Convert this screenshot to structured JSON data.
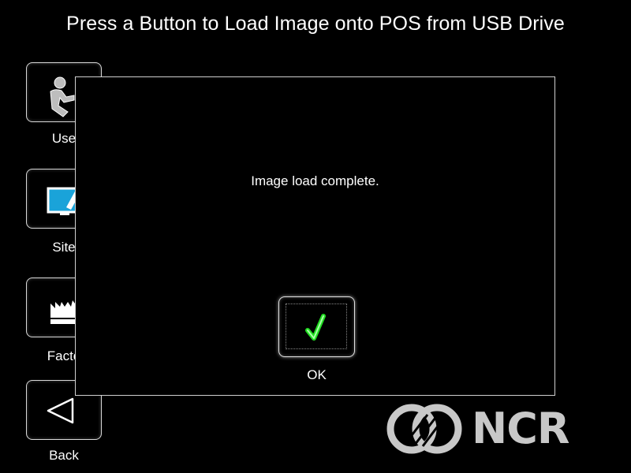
{
  "header": {
    "title": "Press a Button to Load Image onto POS from USB Drive"
  },
  "sidebar": {
    "items": [
      {
        "label": "Use",
        "icon": "user-icon"
      },
      {
        "label": "Site",
        "icon": "monitor-icon"
      },
      {
        "label": "Facto",
        "icon": "factory-icon"
      },
      {
        "label": "Back",
        "icon": "back-triangle-icon"
      }
    ]
  },
  "dialog": {
    "message": "Image load complete.",
    "ok_label": "OK",
    "ok_icon": "checkmark-icon",
    "ok_icon_color": "#22dd22"
  },
  "brand": {
    "name": "NCR",
    "color": "#c8c8c8"
  },
  "colors": {
    "background": "#000000",
    "text": "#ffffff",
    "monitor_accent": "#1aa3d9"
  }
}
